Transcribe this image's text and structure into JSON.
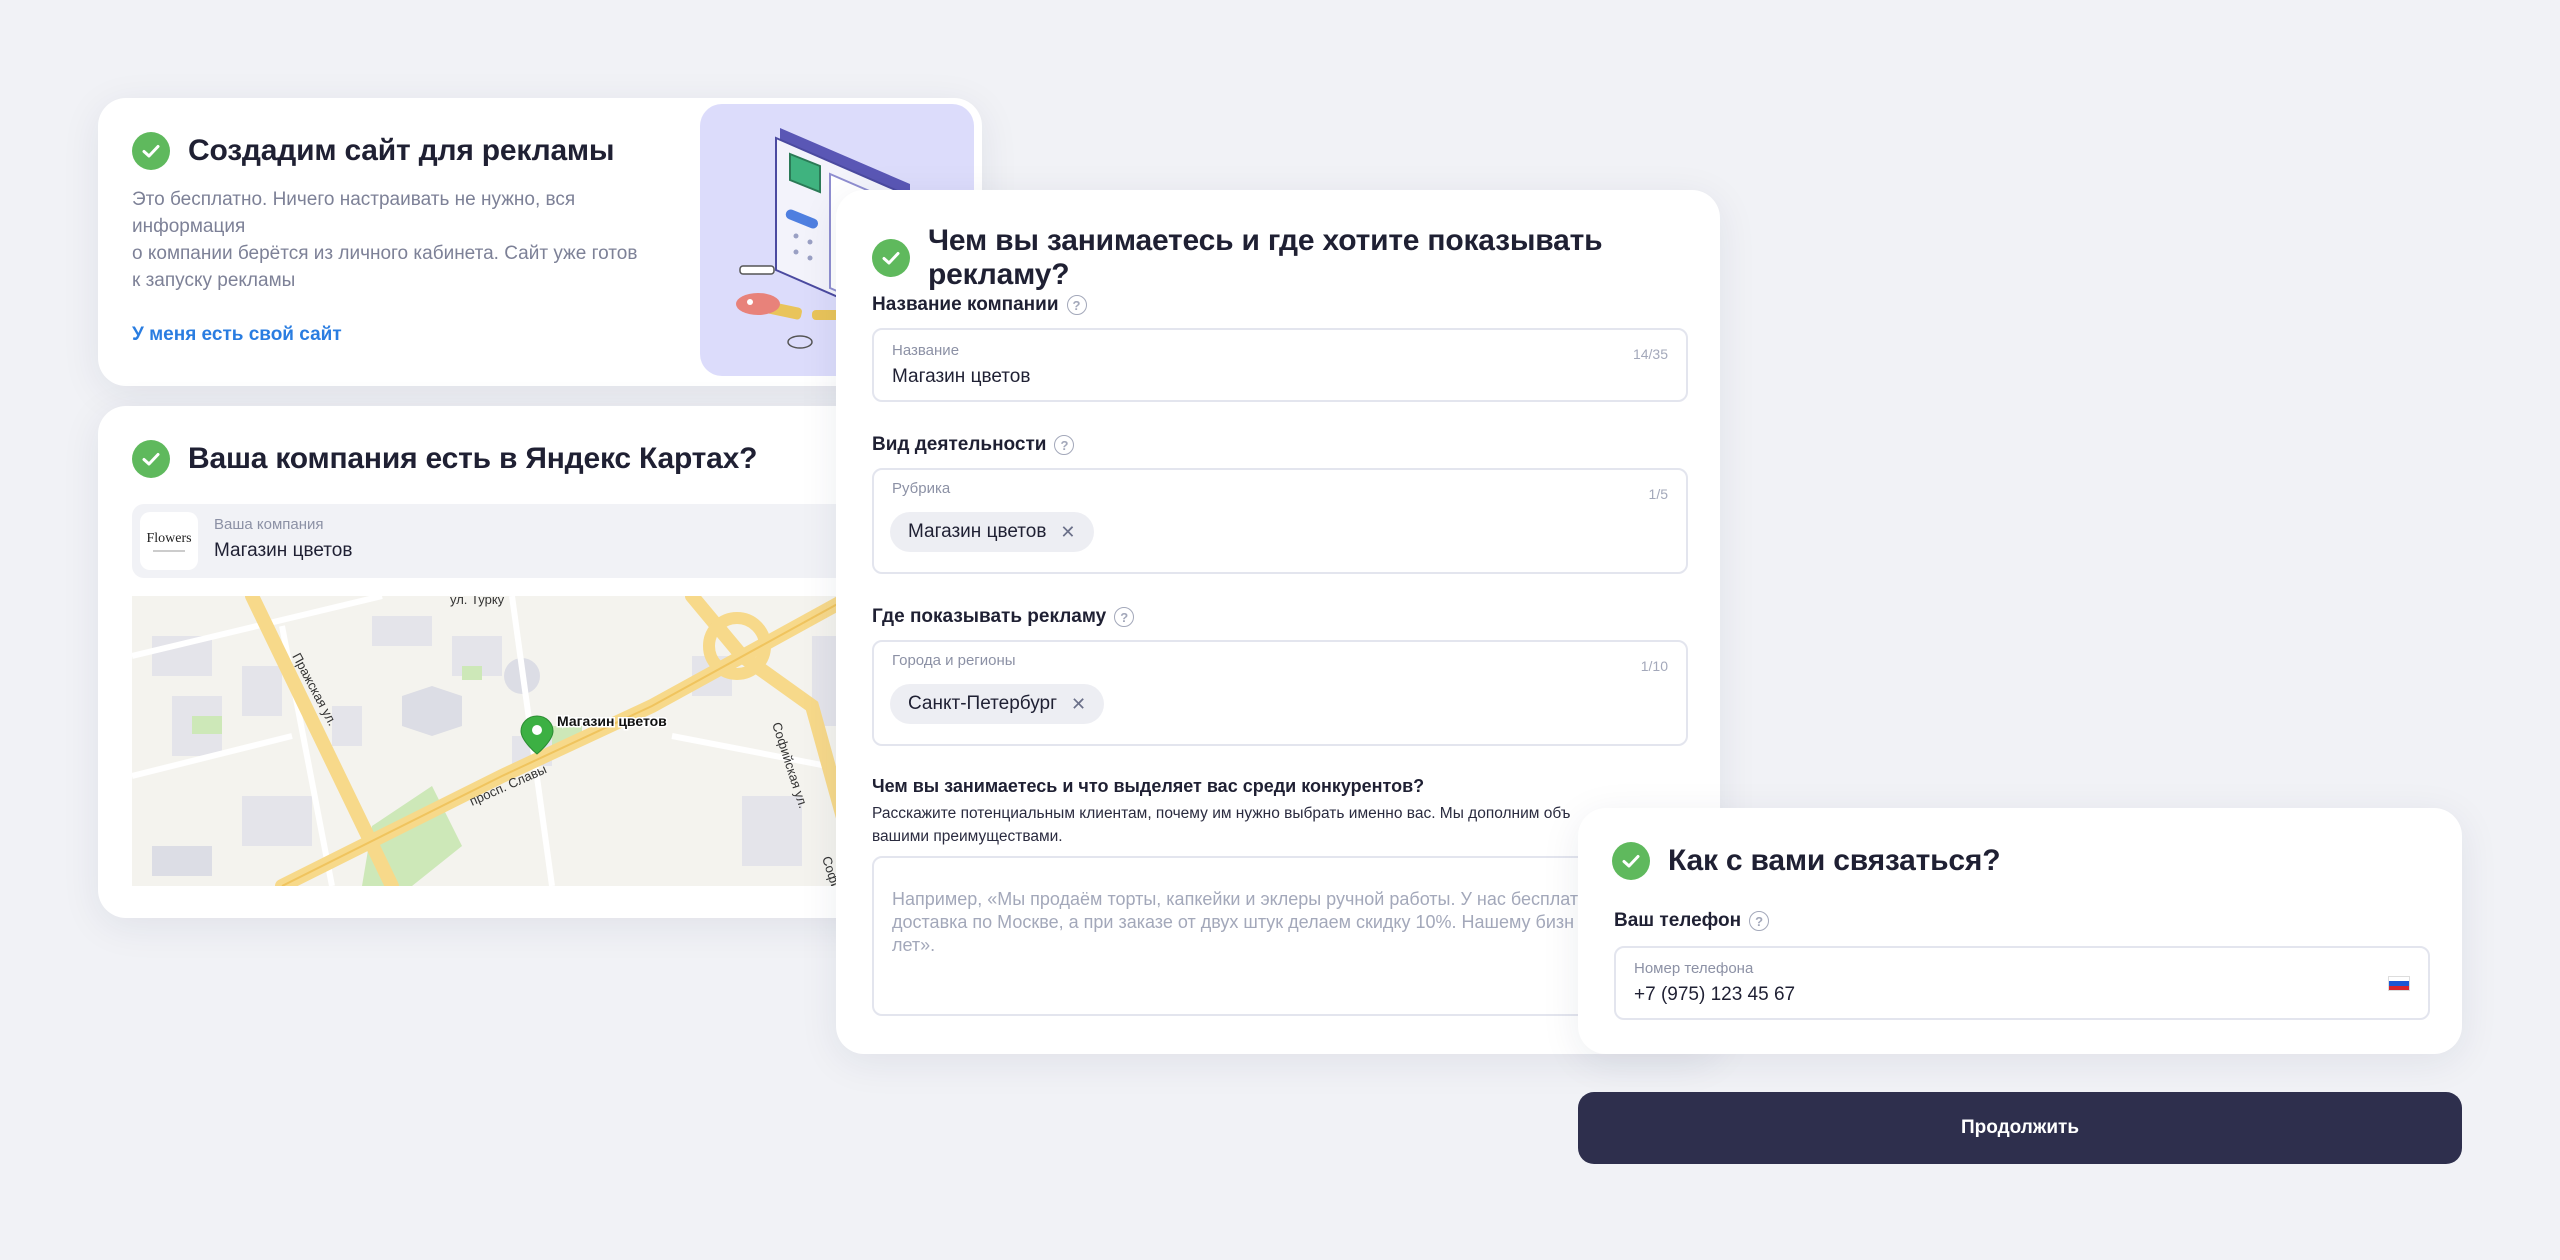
{
  "site_card": {
    "title": "Создадим сайт для рекламы",
    "description_line1": "Это бесплатно. Ничего настраивать не нужно, вся информация",
    "description_line2": "о компании берётся из личного кабинета. Сайт уже готов",
    "description_line3": "к запуску рекламы",
    "own_site_link": "У меня есть свой сайт"
  },
  "maps_card": {
    "title": "Ваша компания есть в Яндекс Картах?",
    "company_caption": "Ваша компания",
    "company_name": "Магазин цветов",
    "logo_text": "Flowers",
    "map": {
      "pin_label": "Магазин цветов",
      "streets": [
        "Пражская ул.",
        "просп. Славы",
        "Софийская ул.",
        "ул. Турку",
        "Софий"
      ]
    }
  },
  "activity_card": {
    "title": "Чем вы занимаетесь и где хотите показывать рекламу?",
    "company_name_label": "Название компании",
    "company_name_field": {
      "caption": "Название",
      "value": "Магазин цветов",
      "counter": "14/35"
    },
    "activity_label": "Вид деятельности",
    "activity_field": {
      "caption": "Рубрика",
      "counter": "1/5",
      "chip": "Магазин цветов"
    },
    "regions_label": "Где показывать рекламу",
    "regions_field": {
      "caption": "Города и регионы",
      "counter": "1/10",
      "chip": "Санкт-Петербург"
    },
    "about_label": "Чем вы занимаетесь и что выделяет вас среди конкурентов?",
    "about_hint_line1": "Расскажите потенциальным клиентам, почему им нужно выбрать именно вас. Мы дополним объ",
    "about_hint_line2": "вашими преимуществами.",
    "about_placeholder_line1": "Например, «Мы продаём торты, капкейки и эклеры ручной работы. У нас бесплат",
    "about_placeholder_line2": "доставка по Москве, а при заказе от двух штук делаем скидку 10%. Нашему бизн",
    "about_placeholder_line3": "лет»."
  },
  "contact_card": {
    "title": "Как с вами связаться?",
    "phone_label": "Ваш телефон",
    "phone_caption": "Номер телефона",
    "phone_value": "+7 (975) 123 45 67",
    "flag_icon": "russia-flag-icon"
  },
  "continue_button": "Продолжить",
  "colors": {
    "accent_green": "#5fb95d",
    "link_blue": "#2a7de1",
    "button_dark": "#2e2f4d",
    "illustration_bg": "#dcdcfb"
  }
}
